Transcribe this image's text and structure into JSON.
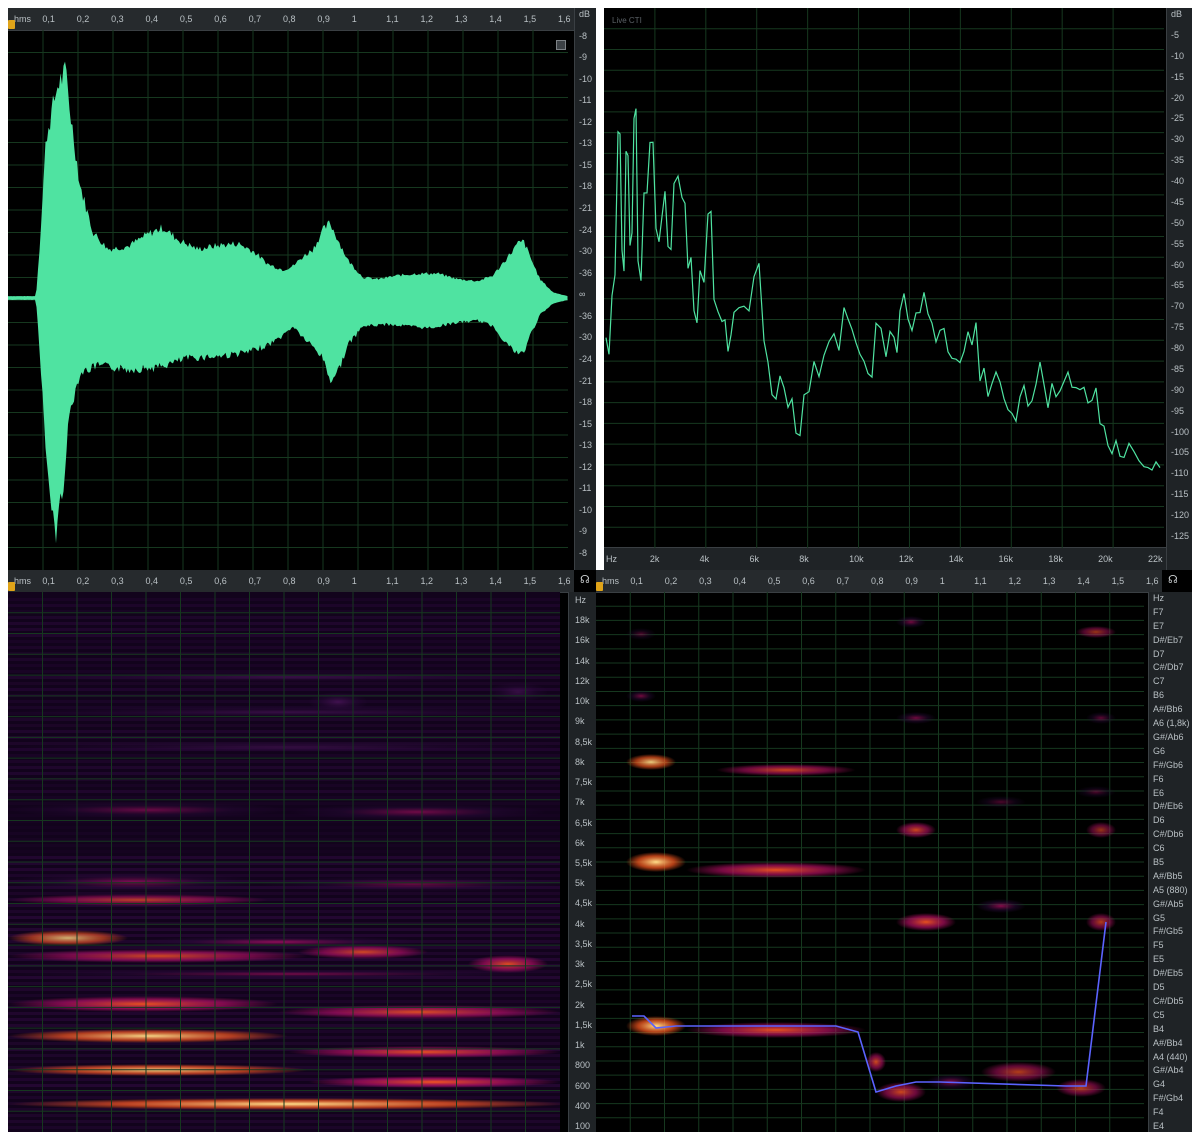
{
  "time_axis": {
    "ticks": [
      "hms",
      "0,1",
      "0,2",
      "0,3",
      "0,4",
      "0,5",
      "0,6",
      "0,7",
      "0,8",
      "0,9",
      "1",
      "1,1",
      "1,2",
      "1,3",
      "1,4",
      "1,5",
      "1,6"
    ]
  },
  "waveform_panel": {
    "db_ticks": [
      "dB",
      "-8",
      "-9",
      "-10",
      "-11",
      "-12",
      "-13",
      "-15",
      "-18",
      "-21",
      "-24",
      "-30",
      "-36",
      "∞",
      "-36",
      "-30",
      "-24",
      "-21",
      "-18",
      "-15",
      "-13",
      "-12",
      "-11",
      "-10",
      "-9",
      "-8"
    ],
    "color": "#4fe3a1"
  },
  "spectrum_panel": {
    "title": "Live CTI",
    "db_ticks": [
      "dB",
      "-5",
      "-10",
      "-15",
      "-20",
      "-25",
      "-30",
      "-35",
      "-40",
      "-45",
      "-50",
      "-55",
      "-60",
      "-65",
      "-70",
      "-75",
      "-80",
      "-85",
      "-90",
      "-95",
      "-100",
      "-105",
      "-110",
      "-115",
      "-120",
      "-125"
    ],
    "hz_ticks": [
      "Hz",
      "2k",
      "4k",
      "6k",
      "8k",
      "10k",
      "12k",
      "14k",
      "16k",
      "18k",
      "20k",
      "22k"
    ],
    "color": "#4fe3a1"
  },
  "spectrogram_panel": {
    "hz_ticks": [
      "Hz",
      "18k",
      "16k",
      "14k",
      "12k",
      "10k",
      "9k",
      "8,5k",
      "8k",
      "7,5k",
      "7k",
      "6,5k",
      "6k",
      "5,5k",
      "5k",
      "4,5k",
      "4k",
      "3,5k",
      "3k",
      "2,5k",
      "2k",
      "1,5k",
      "1k",
      "800",
      "600",
      "400",
      "100"
    ]
  },
  "pitch_panel": {
    "note_ticks": [
      "Hz",
      "F7",
      "E7",
      "D#/Eb7",
      "D7",
      "C#/Db7",
      "C7",
      "B6",
      "A#/Bb6",
      "A6 (1,8k)",
      "G#/Ab6",
      "G6",
      "F#/Gb6",
      "F6",
      "E6",
      "D#/Eb6",
      "D6",
      "C#/Db6",
      "C6",
      "B5",
      "A#/Bb5",
      "A5 (880)",
      "G#/Ab5",
      "G5",
      "F#/Gb5",
      "F5",
      "E5",
      "D#/Eb5",
      "D5",
      "C#/Db5",
      "C5",
      "B4",
      "A#/Bb4",
      "A4 (440)",
      "G#/Ab4",
      "G4",
      "F#/Gb4",
      "F4",
      "E4"
    ],
    "pitch_line_color": "#5b63ff"
  },
  "colors": {
    "panel_bg": "#000000",
    "ruler_bg": "#262a2d",
    "grid": "#16381f",
    "accent_playhead": "#e0a419",
    "heat_low": "#2a0a3a",
    "heat_mid": "#c0106a",
    "heat_high": "#ff5a20",
    "heat_peak": "#ffe08a"
  },
  "icons": {
    "monitor": "headphones-icon",
    "playhead": "playhead-marker-icon",
    "settings": "panel-settings-icon"
  }
}
